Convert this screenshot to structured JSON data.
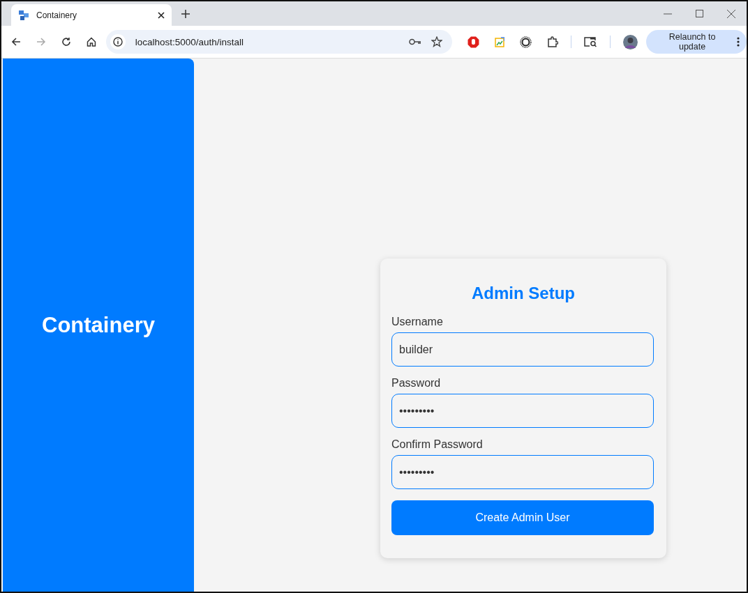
{
  "browser": {
    "tab": {
      "title": "Containery",
      "selected": true
    },
    "address": "localhost:5000/auth/install",
    "relaunch": "Relaunch to update"
  },
  "sidebar": {
    "brand": "Containery"
  },
  "form": {
    "title": "Admin Setup",
    "fields": [
      {
        "label": "Username",
        "value": "builder"
      },
      {
        "label": "Password",
        "value": "•••••••••"
      },
      {
        "label": "Confirm Password",
        "value": "•••••••••"
      }
    ],
    "submit": "Create Admin User"
  }
}
